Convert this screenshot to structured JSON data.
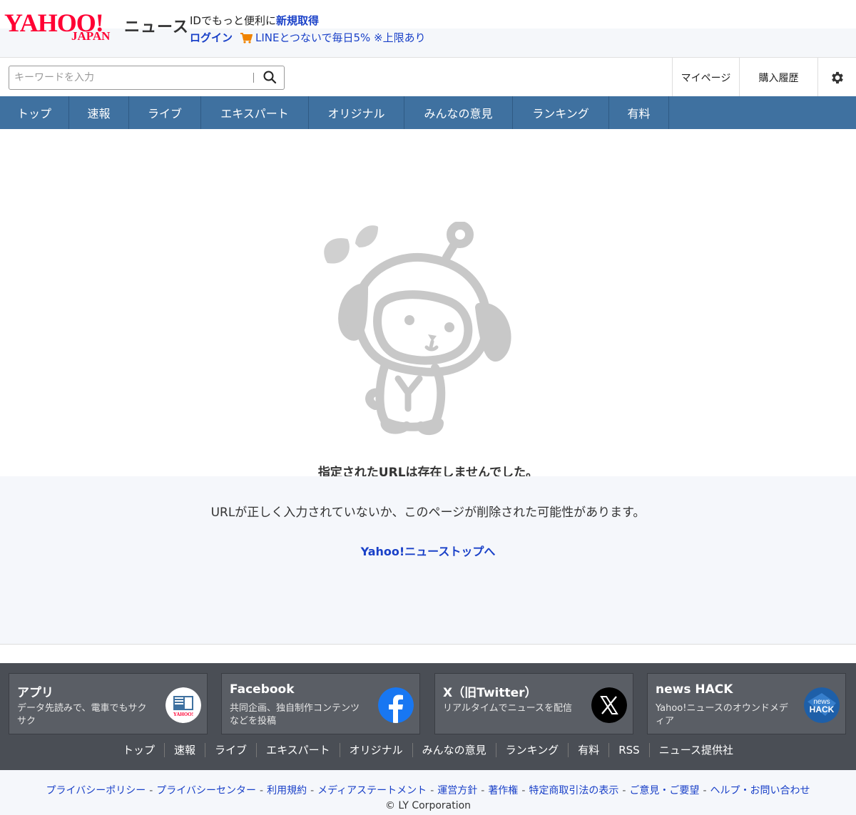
{
  "header": {
    "logo_main": "YAHOO!",
    "logo_sub": "JAPAN",
    "service_name": "ニュース",
    "id_promo_text": "IDでもっと便利に",
    "signup_link": "新規取得",
    "login_link": "ログイン",
    "line_promo": "LINEとつないで毎日5% ※上限あり"
  },
  "search": {
    "placeholder": "キーワードを入力"
  },
  "top_links": {
    "mypage": "マイページ",
    "history": "購入履歴"
  },
  "nav": {
    "items": [
      {
        "label": "トップ"
      },
      {
        "label": "速報"
      },
      {
        "label": "ライブ"
      },
      {
        "label": "エキスパート"
      },
      {
        "label": "オリジナル"
      },
      {
        "label": "みんなの意見"
      },
      {
        "label": "ランキング"
      },
      {
        "label": "有料"
      }
    ]
  },
  "error": {
    "title": "指定されたURLは存在しませんでした。",
    "description": "URLが正しく入力されていないか、このページが削除された可能性があります。",
    "top_link": "Yahoo!ニューストップへ"
  },
  "promos": [
    {
      "title": "アプリ",
      "desc": "データ先読みで、電車でもサクサク"
    },
    {
      "title": "Facebook",
      "desc": "共同企画、独自制作コンテンツなどを投稿"
    },
    {
      "title": "X（旧Twitter）",
      "desc": "リアルタイムでニュースを配信"
    },
    {
      "title": "news HACK",
      "desc": "Yahoo!ニュースのオウンドメディア"
    }
  ],
  "promo_icon_text": {
    "app_logo": "YAHOO!",
    "news_hack_top": "news",
    "news_hack_bottom": "HACK"
  },
  "footer_nav": {
    "items": [
      {
        "label": "トップ"
      },
      {
        "label": "速報"
      },
      {
        "label": "ライブ"
      },
      {
        "label": "エキスパート"
      },
      {
        "label": "オリジナル"
      },
      {
        "label": "みんなの意見"
      },
      {
        "label": "ランキング"
      },
      {
        "label": "有料"
      },
      {
        "label": "RSS"
      },
      {
        "label": "ニュース提供社"
      }
    ]
  },
  "legal_links": [
    {
      "label": "プライバシーポリシー"
    },
    {
      "label": "プライバシーセンター"
    },
    {
      "label": "利用規約"
    },
    {
      "label": "メディアステートメント"
    },
    {
      "label": "運営方針"
    },
    {
      "label": "著作権"
    },
    {
      "label": "特定商取引法の表示"
    },
    {
      "label": "ご意見・ご要望"
    },
    {
      "label": "ヘルプ・お問い合わせ"
    }
  ],
  "legal_separator": "-",
  "copyright": "© LY Corporation",
  "colors": {
    "brand_red": "#ff0033",
    "link_blue": "#1a41c8",
    "nav_blue": "#3f71a0",
    "footer_dark": "#4a4e55"
  }
}
